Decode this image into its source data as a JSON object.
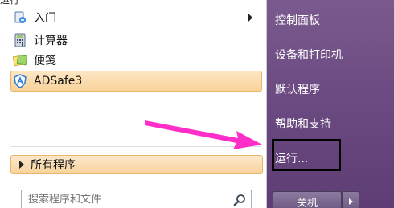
{
  "left_menu": {
    "top_clipped_text": "运行",
    "items": [
      {
        "label": "入门",
        "icon": "getting-started-icon"
      },
      {
        "label": "计算器",
        "icon": "calculator-icon"
      },
      {
        "label": "便笺",
        "icon": "sticky-notes-icon"
      },
      {
        "label": "ADSafe3",
        "icon": "adsafe-icon"
      }
    ],
    "all_programs": "所有程序",
    "search_placeholder": "搜索程序和文件"
  },
  "right_menu": {
    "items": [
      {
        "label": "控制面板"
      },
      {
        "label": "设备和打印机"
      },
      {
        "label": "默认程序"
      },
      {
        "label": "帮助和支持"
      },
      {
        "label": "运行..."
      }
    ],
    "shutdown_label": "关机"
  },
  "colors": {
    "right_pane": "#6c4b82",
    "highlight": "#f9d39a",
    "annotation_arrow": "#ff2ec8",
    "annotation_box": "#000000"
  }
}
